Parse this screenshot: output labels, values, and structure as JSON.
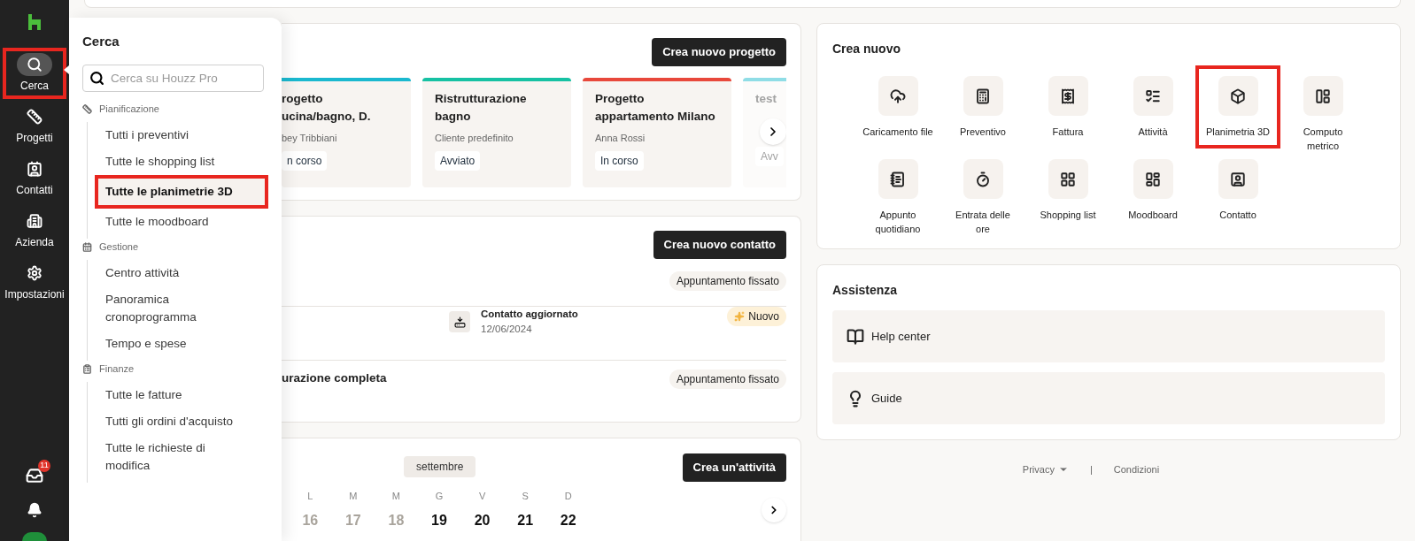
{
  "nav": {
    "items": [
      {
        "label": "Cerca",
        "selected": true,
        "highlighted": true
      },
      {
        "label": "Progetti",
        "selected": false,
        "highlighted": false
      },
      {
        "label": "Contatti",
        "selected": false,
        "highlighted": false
      },
      {
        "label": "Azienda",
        "selected": false,
        "highlighted": false
      },
      {
        "label": "Impostazioni",
        "selected": false,
        "highlighted": false
      }
    ],
    "inbox_badge": "11"
  },
  "search_panel": {
    "title": "Cerca",
    "search": {
      "placeholder": "Cerca su Houzz Pro"
    },
    "sections": [
      {
        "label": "Pianificazione",
        "items": [
          {
            "label": "Tutti i preventivi",
            "selected": false,
            "highlighted": false
          },
          {
            "label": "Tutte le shopping list",
            "selected": false,
            "highlighted": false
          },
          {
            "label": "Tutte le planimetrie 3D",
            "selected": true,
            "highlighted": true
          },
          {
            "label": "Tutte le moodboard",
            "selected": false,
            "highlighted": false
          }
        ]
      },
      {
        "label": "Gestione",
        "items": [
          {
            "label": "Centro attività",
            "selected": false,
            "highlighted": false
          },
          {
            "label": "Panoramica cronoprogramma",
            "selected": false,
            "highlighted": false
          },
          {
            "label": "Tempo e spese",
            "selected": false,
            "highlighted": false
          }
        ]
      },
      {
        "label": "Finanze",
        "items": [
          {
            "label": "Tutte le fatture",
            "selected": false,
            "highlighted": false
          },
          {
            "label": "Tutti gli ordini d'acquisto",
            "selected": false,
            "highlighted": false
          },
          {
            "label": "Tutte le richieste di modifica",
            "selected": false,
            "highlighted": false
          }
        ]
      }
    ]
  },
  "projects": {
    "button": "Crea nuovo progetto",
    "cards": [
      {
        "title": "rogetto\nucina/bagno, D.",
        "client": "bey Tribbiani",
        "status": "n corso",
        "color": "#1ab8cf"
      },
      {
        "title": "Ristrutturazione bagno",
        "client": "Cliente predefinito",
        "status": "Avviato",
        "color": "#16c1a3"
      },
      {
        "title": "Progetto appartamento Milano",
        "client": "Anna Rossi",
        "status": "In corso",
        "color": "#e8483b"
      },
      {
        "title": "test",
        "status": "Avv",
        "color": "#8fdde6"
      }
    ]
  },
  "contacts": {
    "button": "Crea nuovo contatto",
    "rows": [
      {
        "kind": "badge",
        "badge": "Appuntamento fissato"
      },
      {
        "kind": "activity",
        "activity": "Contatto aggiornato",
        "date": "12/06/2024",
        "badge": "Nuovo"
      },
      {
        "kind": "badge",
        "name": "urazione completa",
        "badge": "Appuntamento fissato"
      }
    ]
  },
  "calendar": {
    "month": "settembre",
    "button": "Crea un'attività",
    "weekdays": [
      "L",
      "M",
      "M",
      "G",
      "V",
      "S",
      "D"
    ],
    "days": [
      {
        "label": "16",
        "past": true
      },
      {
        "label": "17",
        "past": true
      },
      {
        "label": "18",
        "past": true
      },
      {
        "label": "19",
        "past": false
      },
      {
        "label": "20",
        "past": false
      },
      {
        "label": "21",
        "past": false
      },
      {
        "label": "22",
        "past": false
      }
    ]
  },
  "create_new": {
    "title": "Crea nuovo",
    "items": [
      {
        "label": "Caricamento file",
        "highlighted": false
      },
      {
        "label": "Preventivo",
        "highlighted": false
      },
      {
        "label": "Fattura",
        "highlighted": false
      },
      {
        "label": "Attività",
        "highlighted": false
      },
      {
        "label": "Planimetria 3D",
        "highlighted": true
      },
      {
        "label": "Computo metrico",
        "highlighted": false
      },
      {
        "label": "Appunto quotidiano",
        "highlighted": false
      },
      {
        "label": "Entrata delle ore",
        "highlighted": false
      },
      {
        "label": "Shopping list",
        "highlighted": false
      },
      {
        "label": "Moodboard",
        "highlighted": false
      },
      {
        "label": "Contatto",
        "highlighted": false
      }
    ]
  },
  "assistance": {
    "title": "Assistenza",
    "links": [
      "Help center",
      "Guide"
    ]
  },
  "footer": {
    "links": [
      "Privacy",
      "Condizioni"
    ],
    "separator": "|"
  }
}
